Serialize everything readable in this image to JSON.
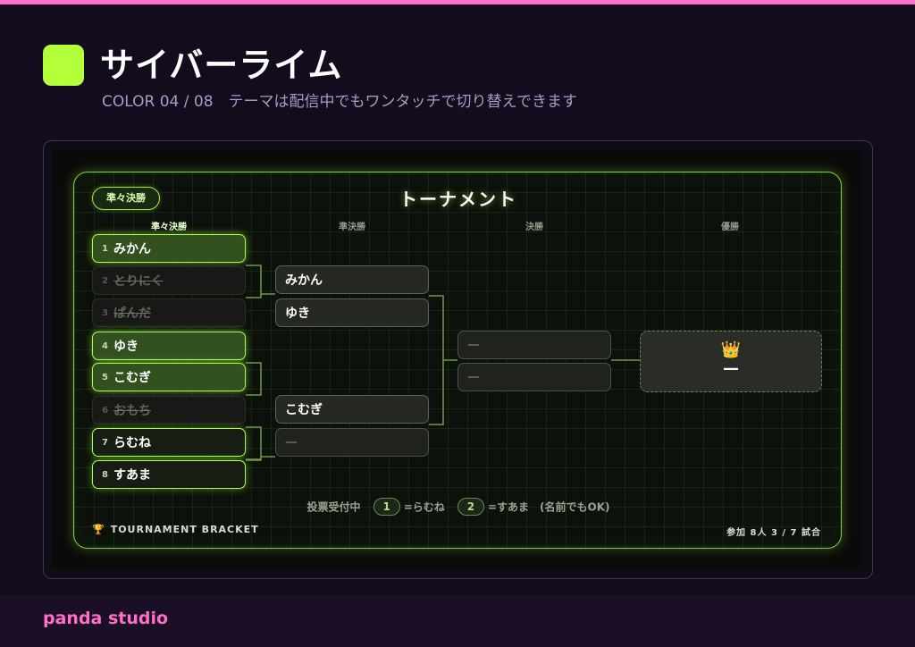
{
  "page": {
    "title": "サイバーライム",
    "subtitle": "COLOR 04 / 08　テーマは配信中でもワンタッチで切り替えできます",
    "brand": "panda studio",
    "accent_color": "#b2ff3a",
    "brand_color": "#ff6ec7"
  },
  "card": {
    "round_badge": "準々決勝",
    "title": "トーナメント",
    "columns": [
      "準々決勝",
      "準決勝",
      "決勝",
      "優勝"
    ],
    "quarterfinals": [
      {
        "seed": "1",
        "name": "みかん",
        "state": "win"
      },
      {
        "seed": "2",
        "name": "とりにく",
        "state": "lost"
      },
      {
        "seed": "3",
        "name": "ぱんだ",
        "state": "lost"
      },
      {
        "seed": "4",
        "name": "ゆき",
        "state": "win"
      },
      {
        "seed": "5",
        "name": "こむぎ",
        "state": "win"
      },
      {
        "seed": "6",
        "name": "おもち",
        "state": "lost"
      },
      {
        "seed": "7",
        "name": "らむね",
        "state": "alive"
      },
      {
        "seed": "8",
        "name": "すあま",
        "state": "alive"
      }
    ],
    "semifinals": [
      {
        "name": "みかん"
      },
      {
        "name": "ゆき"
      },
      {
        "name": "こむぎ"
      },
      {
        "name": "—"
      }
    ],
    "final": [
      {
        "name": "—"
      },
      {
        "name": "—"
      }
    ],
    "champion": {
      "icon": "crown-icon",
      "glyph": "👑",
      "name": "—"
    },
    "vote": {
      "label": "投票受付中",
      "option1_num": "1",
      "option1_text": "=らむね",
      "option2_num": "2",
      "option2_text": "=すあま　(名前でもOK)"
    },
    "footer": {
      "icon": "trophy-icon",
      "left": "TOURNAMENT BRACKET",
      "right": "参加 8人 3 / 7 試合"
    }
  }
}
